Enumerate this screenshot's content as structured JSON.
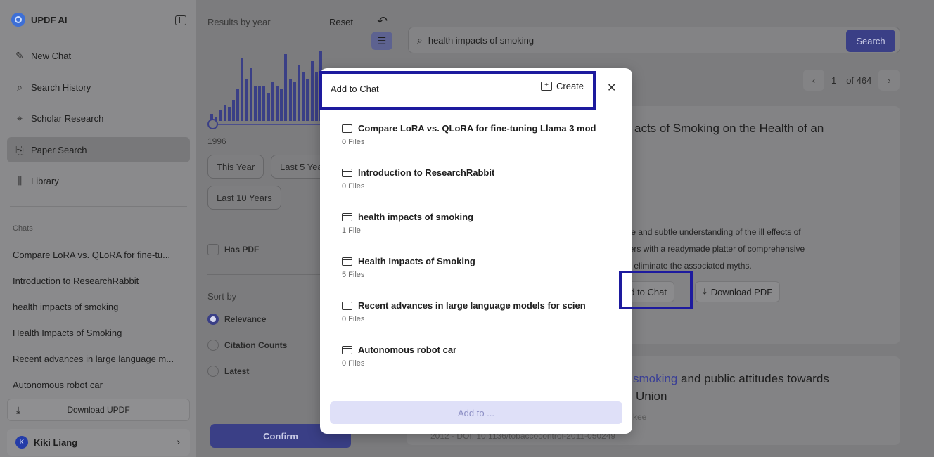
{
  "app": {
    "name": "UPDF AI"
  },
  "sidebar": {
    "nav": [
      {
        "label": "New Chat",
        "icon": "edit-icon"
      },
      {
        "label": "Search History",
        "icon": "search-icon"
      },
      {
        "label": "Scholar Research",
        "icon": "telescope-icon"
      },
      {
        "label": "Paper Search",
        "icon": "paper-search-icon",
        "active": true
      },
      {
        "label": "Library",
        "icon": "library-icon"
      }
    ],
    "chats_label": "Chats",
    "chats": [
      "Compare LoRA vs. QLoRA for fine-tu...",
      "Introduction to ResearchRabbit",
      "health impacts of smoking",
      "Health Impacts of Smoking",
      "Recent advances in large language m...",
      "Autonomous robot car"
    ],
    "download_label": "Download UPDF",
    "user": {
      "initial": "K",
      "name": "Kiki Liang"
    }
  },
  "filters": {
    "title": "Results by year",
    "reset": "Reset",
    "histogram": [
      0.1,
      0.05,
      0.15,
      0.22,
      0.2,
      0.3,
      0.45,
      0.9,
      0.6,
      0.75,
      0.5,
      0.5,
      0.5,
      0.4,
      0.55,
      0.5,
      0.45,
      0.95,
      0.6,
      0.55,
      0.8,
      0.7,
      0.6,
      0.85,
      0.7,
      1.0
    ],
    "start_year": "1996",
    "chips": [
      "This Year",
      "Last 5 Years",
      "Last 10 Years"
    ],
    "has_pdf": "Has PDF",
    "sort_label": "Sort by",
    "sort_options": [
      "Relevance",
      "Citation Counts",
      "Latest"
    ],
    "sort_selected": "Relevance",
    "confirm": "Confirm"
  },
  "search": {
    "query": "health impacts of smoking",
    "button": "Search"
  },
  "pager": {
    "current": "1",
    "of_label": "of 464"
  },
  "results": [
    {
      "title_line": "acts of Smoking on the Health of an",
      "abstract_lines": [
        "ple and subtle understanding of the ill effects of",
        "ders with a readymade platter of comprehensive",
        "to eliminate the associated myths."
      ],
      "add_label": "dd to Chat",
      "download_label": "Download PDF"
    },
    {
      "title_highlight": "smoking",
      "title_rest": " and public attitudes towards",
      "title_line2": "Union",
      "author": "kee",
      "meta": "2012 · DOI: 10.1136/tobaccocontrol-2011-050249"
    }
  ],
  "modal": {
    "title": "Add to Chat",
    "create": "Create",
    "folders": [
      {
        "name": "Compare LoRA vs. QLoRA for fine-tuning Llama 3 mod",
        "count": "0 Files"
      },
      {
        "name": "Introduction to ResearchRabbit",
        "count": "0 Files"
      },
      {
        "name": "health impacts of smoking",
        "count": "1 File"
      },
      {
        "name": "Health Impacts of Smoking",
        "count": "5 Files"
      },
      {
        "name": "Recent advances in large language models for scien",
        "count": "0 Files"
      },
      {
        "name": "Autonomous robot car",
        "count": "0 Files"
      }
    ],
    "add_to": "Add to ..."
  },
  "colors": {
    "accent": "#4f55d6",
    "annotation": "#1d1a9e"
  }
}
